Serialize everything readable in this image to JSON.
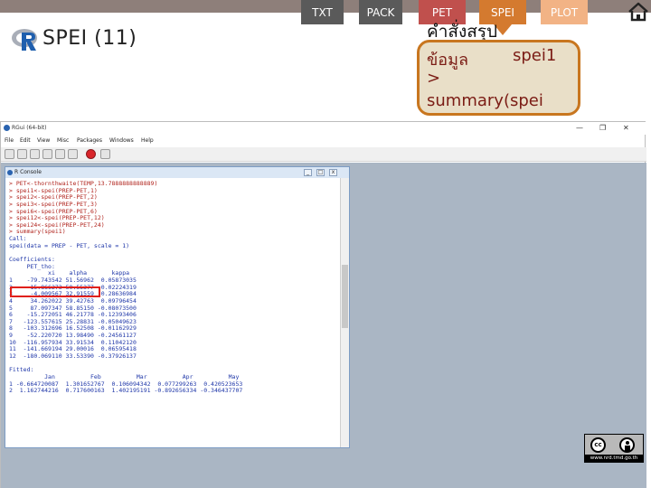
{
  "slide": {
    "title": "SPEI (11)",
    "nav_tabs": [
      "TXT",
      "PACK",
      "PET",
      "SPEI",
      "PLOT"
    ],
    "active_tab": "SPEI"
  },
  "callout": {
    "heading": "คำสั่งสรุป",
    "line1_a": "ข้อมูล",
    "line1_b": "spei1",
    "line2": ">",
    "line3": "summary(spei"
  },
  "rgui": {
    "title": "RGui (64-bit)",
    "menu": [
      "File",
      "Edit",
      "View",
      "Misc",
      "Packages",
      "Windows",
      "Help"
    ],
    "console_title": "R Console"
  },
  "console": {
    "lines": [
      {
        "t": "> PET<-thornthwaite(TEMP,13.7888888888889)",
        "k": "cmd"
      },
      {
        "t": "> spei1<-spei(PREP-PET,1)",
        "k": "cmd"
      },
      {
        "t": "> spei2<-spei(PREP-PET,2)",
        "k": "cmd"
      },
      {
        "t": "> spei3<-spei(PREP-PET,3)",
        "k": "cmd"
      },
      {
        "t": "> spei6<-spei(PREP-PET,6)",
        "k": "cmd"
      },
      {
        "t": "> spei12<-spei(PREP-PET,12)",
        "k": "cmd"
      },
      {
        "t": "> spei24<-spei(PREP-PET,24)",
        "k": "cmd"
      },
      {
        "t": "> summary(spei1)",
        "k": "cmd"
      },
      {
        "t": "Call:",
        "k": "out"
      },
      {
        "t": "spei(data = PREP - PET, scale = 1)",
        "k": "out"
      },
      {
        "t": "",
        "k": "out"
      },
      {
        "t": "Coefficients:",
        "k": "out"
      },
      {
        "t": "     PET_tho:",
        "k": "out"
      },
      {
        "t": "           xi    alpha       kappa",
        "k": "out"
      },
      {
        "t": "1    -79.743542 51.56962  0.05873035",
        "k": "out"
      },
      {
        "t": "2    -15.866273 50.55377 -0.02224319",
        "k": "out"
      },
      {
        "t": "3     -4.009567 32.91559 -0.28636984",
        "k": "out"
      },
      {
        "t": "4     34.262022 39.42763  0.09796454",
        "k": "out"
      },
      {
        "t": "5     87.097347 58.85150 -0.08073500",
        "k": "out"
      },
      {
        "t": "6    -15.272051 46.21778 -0.12393406",
        "k": "out"
      },
      {
        "t": "7   -123.557615 25.28831 -0.05049623",
        "k": "out"
      },
      {
        "t": "8   -103.312696 16.52508 -0.01162929",
        "k": "out"
      },
      {
        "t": "9    -52.220720 13.98490 -0.24561127",
        "k": "out"
      },
      {
        "t": "10  -116.957934 33.91534  0.11042120",
        "k": "out"
      },
      {
        "t": "11  -141.669194 29.00016  0.06595418",
        "k": "out"
      },
      {
        "t": "12  -180.069110 33.53390 -0.37926137",
        "k": "out"
      },
      {
        "t": "",
        "k": "out"
      },
      {
        "t": "Fitted:",
        "k": "out"
      },
      {
        "t": "          Jan          Feb          Mar          Apr          May",
        "k": "out"
      },
      {
        "t": "1 -0.664720087  1.301652767  0.106094342  0.077299263  0.420523653",
        "k": "out"
      },
      {
        "t": "2  1.162744216  0.717600163  1.402195191 -0.892656334 -0.346437707",
        "k": "out"
      }
    ]
  },
  "badge": {
    "cc": "cc",
    "url": "www.nrd.tmd.go.th"
  },
  "colors": {
    "tab_gray": "#5a5a5a",
    "tab_pet": "#c0504d",
    "tab_spei": "#d47a2f",
    "tab_plot": "#f2b385",
    "callout_border": "#c8761f",
    "command_red": "#b0231c",
    "output_blue": "#1e36a8",
    "highlight_red": "#e0201b"
  }
}
